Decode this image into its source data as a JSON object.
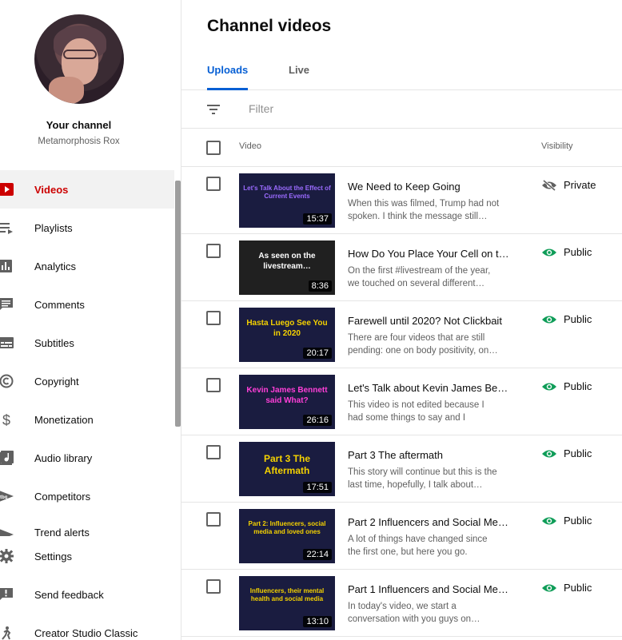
{
  "sidebar": {
    "your_channel": "Your channel",
    "channel_name": "Metamorphosis Rox",
    "items": [
      {
        "label": "Videos",
        "icon": "play-icon",
        "active": true
      },
      {
        "label": "Playlists",
        "icon": "playlist-icon"
      },
      {
        "label": "Analytics",
        "icon": "bar-chart-icon"
      },
      {
        "label": "Comments",
        "icon": "comment-icon"
      },
      {
        "label": "Subtitles",
        "icon": "subtitles-icon"
      },
      {
        "label": "Copyright",
        "icon": "copyright-icon"
      },
      {
        "label": "Monetization",
        "icon": "dollar-icon"
      },
      {
        "label": "Audio library",
        "icon": "music-icon"
      },
      {
        "label": "Competitors",
        "icon": "competitors-icon"
      },
      {
        "label": "Trend alerts",
        "icon": "trend-icon"
      }
    ],
    "bottom_items": [
      {
        "label": "Settings",
        "icon": "gear-icon"
      },
      {
        "label": "Send feedback",
        "icon": "feedback-icon"
      },
      {
        "label": "Creator Studio Classic",
        "icon": "classic-icon"
      }
    ]
  },
  "main": {
    "title": "Channel videos",
    "tabs": [
      {
        "label": "Uploads",
        "active": true
      },
      {
        "label": "Live",
        "active": false
      }
    ],
    "filter_placeholder": "Filter",
    "columns": {
      "video": "Video",
      "visibility": "Visibility"
    },
    "videos": [
      {
        "thumb_text": "Let's Talk About the Effect of Current Events",
        "thumb_color": "#9b6bff",
        "duration": "15:37",
        "title": "We Need to Keep Going",
        "description": "When this was filmed, Trump had not spoken. I think the message still…",
        "visibility": "Private"
      },
      {
        "thumb_text": "As seen on the livestream…",
        "thumb_color": "#ffffff",
        "duration": "8:36",
        "title": "How Do You Place Your Cell on th…",
        "description": "On the first #livestream of the year, we touched on several different…",
        "visibility": "Public"
      },
      {
        "thumb_text": "Hasta Luego See You in 2020",
        "thumb_color": "#f5d200",
        "duration": "20:17",
        "title": "Farewell until 2020? Not Clickbait",
        "description": "There are four videos that are still pending: one on body positivity, on…",
        "visibility": "Public"
      },
      {
        "thumb_text": "Kevin James Bennett said What?",
        "thumb_color": "#ff3fd8",
        "duration": "26:16",
        "title": "Let's Talk about Kevin James Ben…",
        "description": "This video is not edited because I had some things to say and I wante…",
        "visibility": "Public"
      },
      {
        "thumb_text": "Part 3 The Aftermath",
        "thumb_color": "#f5d200",
        "duration": "17:51",
        "title": "Part 3 The aftermath",
        "description": "This story will continue but this is the last time, hopefully, I talk about…",
        "visibility": "Public"
      },
      {
        "thumb_text": "Part 2: Influencers, social media and loved ones",
        "thumb_color": "#f5d200",
        "duration": "22:14",
        "title": "Part 2 Influencers and Social Me…",
        "description": "A lot of things have changed since the first one, but here you go. Enjoy.…",
        "visibility": "Public"
      },
      {
        "thumb_text": "Influencers, their mental health and social media",
        "thumb_color": "#f5d200",
        "duration": "13:10",
        "title": "Part 1 Influencers and Social Me…",
        "description": "In today's video, we start a conversation with you guys on…",
        "visibility": "Public"
      }
    ]
  },
  "colors": {
    "accent_red": "#cc0000",
    "tab_blue": "#065fd4",
    "public_green": "#0f9d58",
    "muted_text": "#606060"
  }
}
